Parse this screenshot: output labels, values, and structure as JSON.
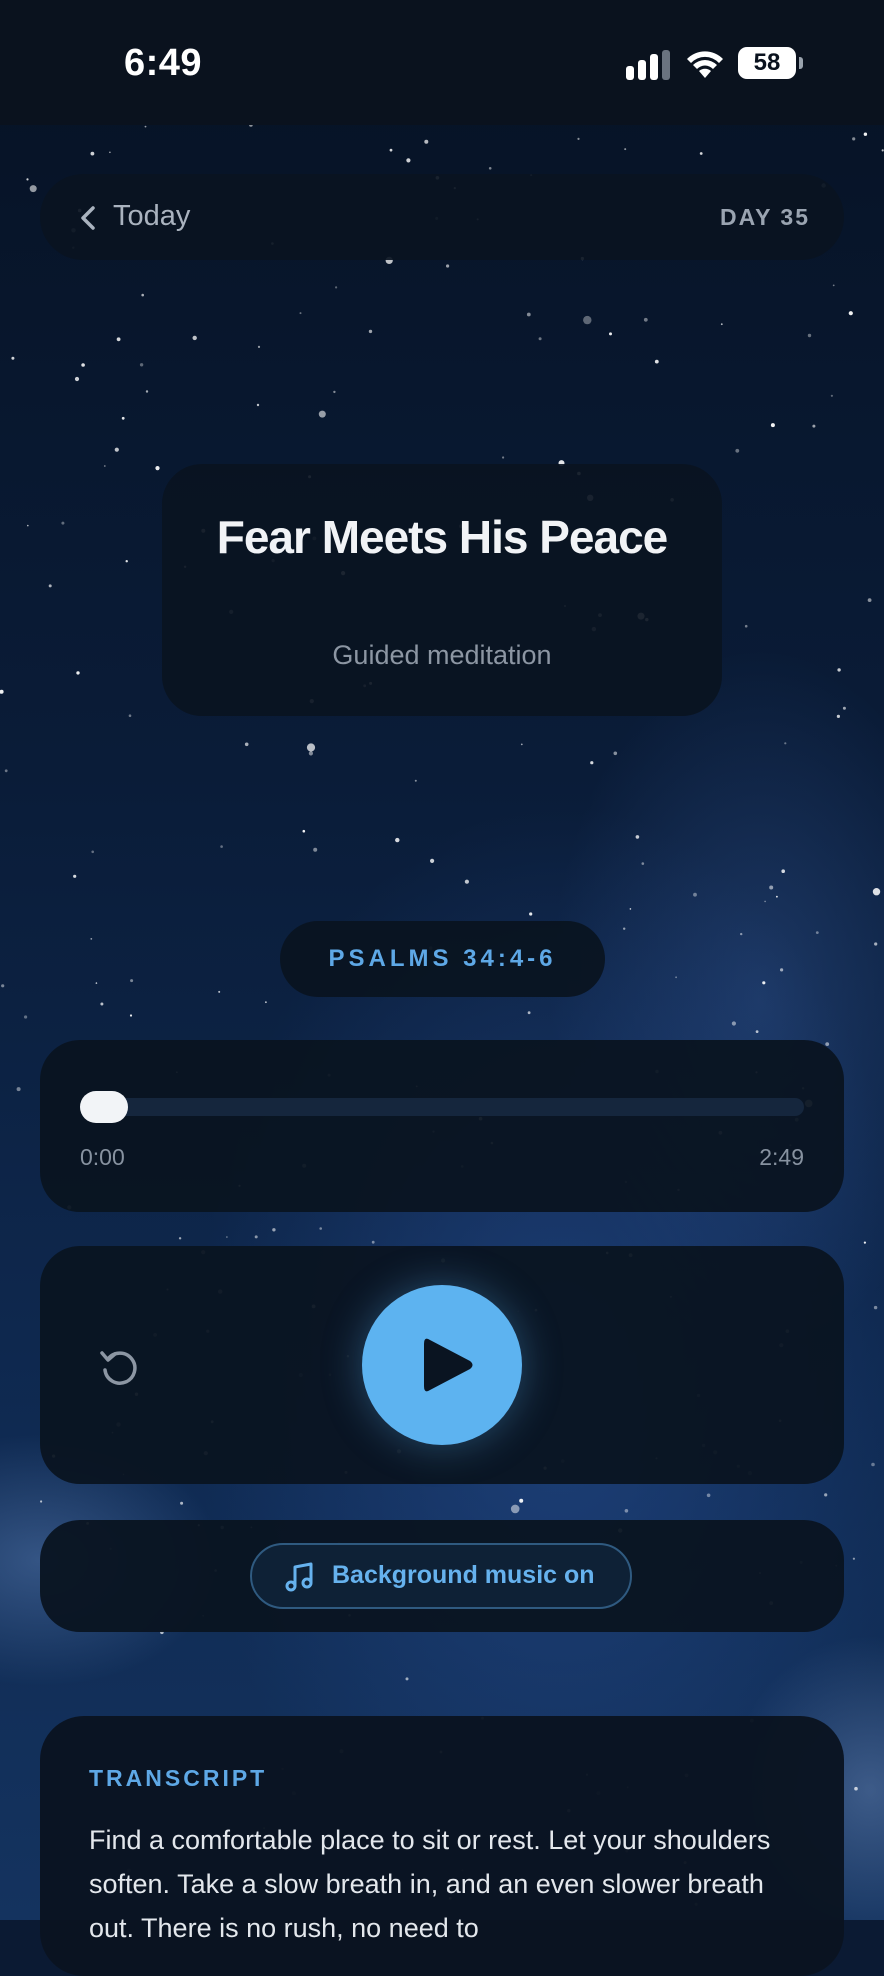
{
  "status_bar": {
    "time": "6:49",
    "battery": "58"
  },
  "header": {
    "back_label": "Today",
    "day": "DAY 35"
  },
  "session": {
    "title": "Fear Meets His Peace",
    "subtitle": "Guided meditation",
    "scripture": "PSALMS 34:4-6"
  },
  "player": {
    "current_time": "0:00",
    "duration": "2:49",
    "progress": 0,
    "music_label": "Background music on"
  },
  "transcript": {
    "heading": "TRANSCRIPT",
    "body": "Find a comfortable place to sit or rest. Let your shoulders soften. Take a slow breath in, and an even slower breath out. There is no rush, no need to"
  },
  "colors": {
    "accent": "#5db3f0",
    "card": "#0a1421",
    "status_bar": "#0a121e"
  },
  "icons": [
    "chevron-left-icon",
    "replay-icon",
    "play-icon",
    "music-note-icon",
    "signal-icon",
    "wifi-icon",
    "battery-icon"
  ]
}
